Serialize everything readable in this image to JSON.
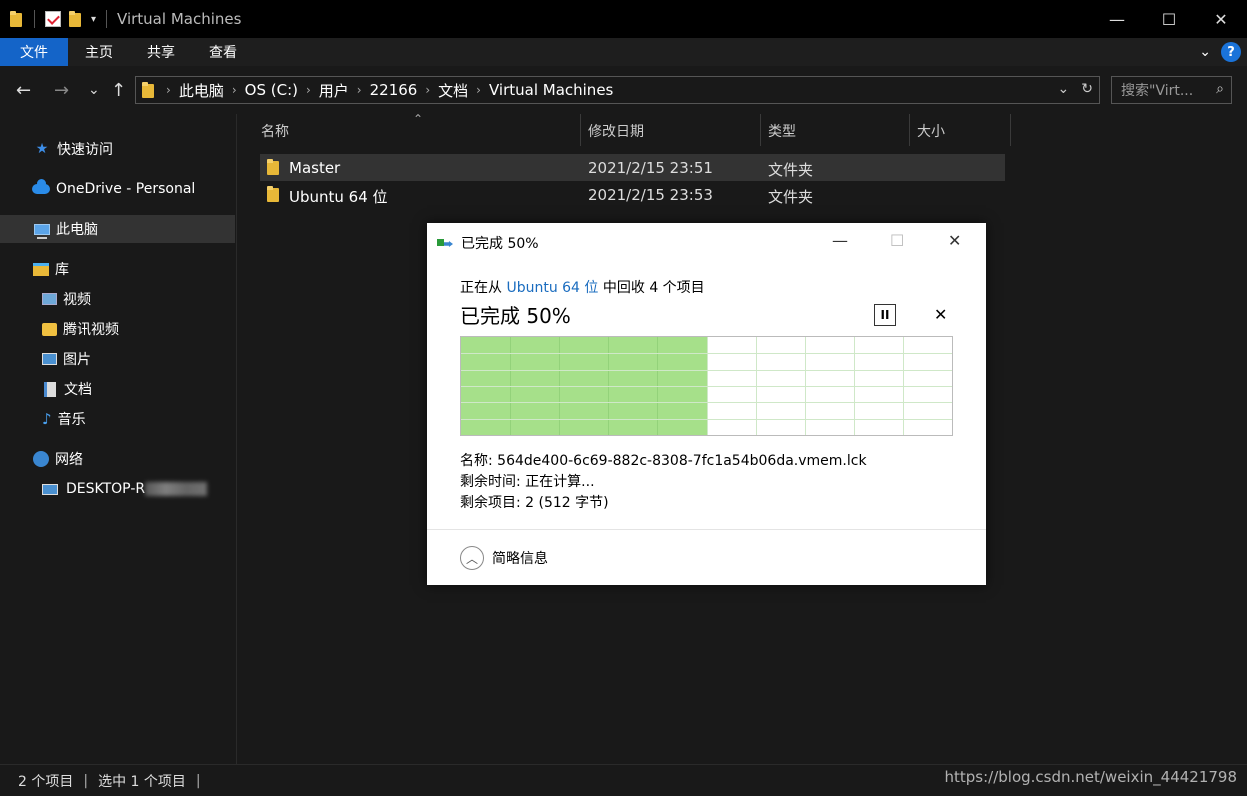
{
  "window": {
    "title": "Virtual Machines",
    "controls": {
      "minimize": "—",
      "maximize": "☐",
      "close": "✕"
    }
  },
  "ribbon": {
    "tabs": [
      {
        "label": "文件",
        "active": true
      },
      {
        "label": "主页"
      },
      {
        "label": "共享"
      },
      {
        "label": "查看"
      }
    ],
    "help_label": "?"
  },
  "address": {
    "crumbs": [
      "此电脑",
      "OS (C:)",
      "用户",
      "22166",
      "文档",
      "Virtual Machines"
    ],
    "search_placeholder": "搜索\"Virt...",
    "nav": {
      "back": "←",
      "forward": "→",
      "recent": "⌄",
      "up": "↑"
    }
  },
  "sidebar": {
    "items": [
      {
        "label": "快速访问",
        "icon": "star-icon"
      },
      {
        "label": "OneDrive - Personal",
        "icon": "onedrive-cloud-icon"
      },
      {
        "label": "此电脑",
        "icon": "this-pc-icon",
        "selected": true
      },
      {
        "label": "库",
        "icon": "library-icon"
      },
      {
        "label": "视频",
        "icon": "video-icon"
      },
      {
        "label": "腾讯视频",
        "icon": "tencent-video-icon"
      },
      {
        "label": "图片",
        "icon": "pictures-icon"
      },
      {
        "label": "文档",
        "icon": "documents-icon"
      },
      {
        "label": "音乐",
        "icon": "music-icon"
      },
      {
        "label": "网络",
        "icon": "network-icon"
      },
      {
        "label": "DESKTOP-R",
        "icon": "desktop-computer-icon"
      }
    ]
  },
  "filelist": {
    "columns": [
      "名称",
      "修改日期",
      "类型",
      "大小"
    ],
    "rows": [
      {
        "name": "Master",
        "date": "2021/2/15 23:51",
        "type": "文件夹",
        "selected": true
      },
      {
        "name": "Ubuntu 64 位",
        "date": "2021/2/15 23:53",
        "type": "文件夹"
      }
    ]
  },
  "status": {
    "item_count": "2 个项目",
    "selected": "选中 1 个项目"
  },
  "watermark": "https://blog.csdn.net/weixin_44421798",
  "dialog": {
    "title": "已完成 50%",
    "line_prefix": "正在从",
    "source_link": "Ubuntu 64 位",
    "line_suffix": "中回收 4 个项目",
    "headline": "已完成 50%",
    "progress": 0.5,
    "pause_label": "II",
    "stop_label": "✕",
    "name_label": "名称:",
    "name_value": "564de400-6c69-882c-8308-7fc1a54b06da.vmem.lck",
    "time_label": "剩余时间:",
    "time_value": "正在计算...",
    "items_label": "剩余项目:",
    "items_value": "2 (512 字节)",
    "more_label": "简略信息",
    "colors": {
      "fill": "#a6e08a",
      "grid": "#cfe8c8",
      "link": "#1a6cbf"
    }
  }
}
